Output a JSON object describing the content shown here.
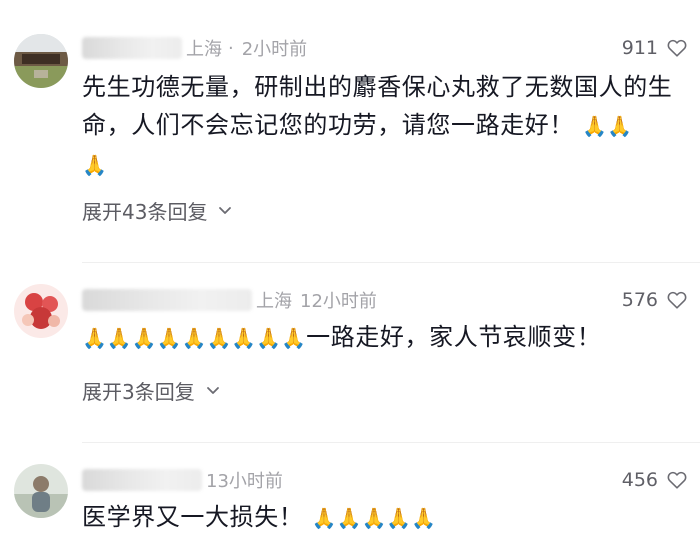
{
  "comments": [
    {
      "location": "上海",
      "time": "2小时前",
      "likes": "911",
      "text": "先生功德无量，研制出的麝香保心丸救了无数国人的生命，人们不会忘记您的功劳，请您一路走好！",
      "emoji_after": "🙏🙏",
      "emoji_line2": "🙏",
      "expand_label": "展开43条回复"
    },
    {
      "location": "上海",
      "time": "12小时前",
      "likes": "576",
      "emoji_before": "🙏🙏🙏🙏🙏🙏🙏🙏🙏",
      "text": "一路走好，家人节哀顺变！",
      "expand_label": "展开3条回复"
    },
    {
      "time": "13小时前",
      "likes": "456",
      "text": "医学界又一大损失！",
      "emoji_after": "🙏🙏🙏🙏🙏"
    }
  ],
  "icons": {
    "like": "heart-outline-icon",
    "expand": "chevron-down-icon",
    "reaction": "folded-hands-emoji"
  },
  "colors": {
    "meta": "#9a9aa0",
    "text": "#161823",
    "secondary": "#5c5c63"
  }
}
